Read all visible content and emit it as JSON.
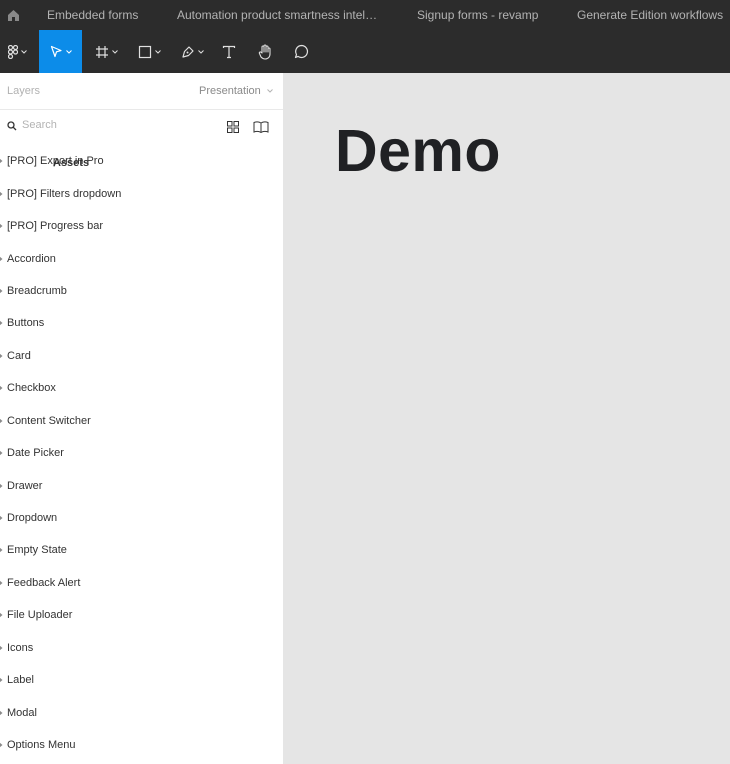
{
  "tabs": [
    {
      "label": "Embedded forms"
    },
    {
      "label": "Automation product smartness intel…"
    },
    {
      "label": "Signup forms - revamp"
    },
    {
      "label": "Generate Edition workflows"
    }
  ],
  "toolbar": {
    "tools": [
      {
        "icon": "figma-menu-icon"
      },
      {
        "icon": "move-tool-icon",
        "active": true
      },
      {
        "icon": "frame-tool-icon"
      },
      {
        "icon": "rectangle-tool-icon"
      },
      {
        "icon": "pen-tool-icon"
      },
      {
        "icon": "text-tool-icon"
      },
      {
        "icon": "hand-tool-icon"
      },
      {
        "icon": "comment-tool-icon"
      }
    ]
  },
  "panel": {
    "tab_layers": "Layers",
    "tab_assets": "Assets",
    "page_selector": "Presentation",
    "search_placeholder": "Search",
    "items": [
      {
        "label": "[PRO] Export in Pro"
      },
      {
        "label": "[PRO] Filters dropdown"
      },
      {
        "label": "[PRO] Progress bar"
      },
      {
        "label": "Accordion"
      },
      {
        "label": "Breadcrumb"
      },
      {
        "label": "Buttons"
      },
      {
        "label": "Card"
      },
      {
        "label": "Checkbox"
      },
      {
        "label": "Content Switcher"
      },
      {
        "label": "Date Picker"
      },
      {
        "label": "Drawer"
      },
      {
        "label": "Dropdown"
      },
      {
        "label": "Empty State"
      },
      {
        "label": "Feedback Alert"
      },
      {
        "label": "File Uploader"
      },
      {
        "label": "Icons"
      },
      {
        "label": "Label"
      },
      {
        "label": "Modal"
      },
      {
        "label": "Options Menu"
      }
    ]
  },
  "canvas": {
    "heading": "Demo"
  },
  "colors": {
    "chrome_bg": "#2c2c2c",
    "accent": "#0c8ce9",
    "canvas_bg": "#e5e5e5"
  }
}
